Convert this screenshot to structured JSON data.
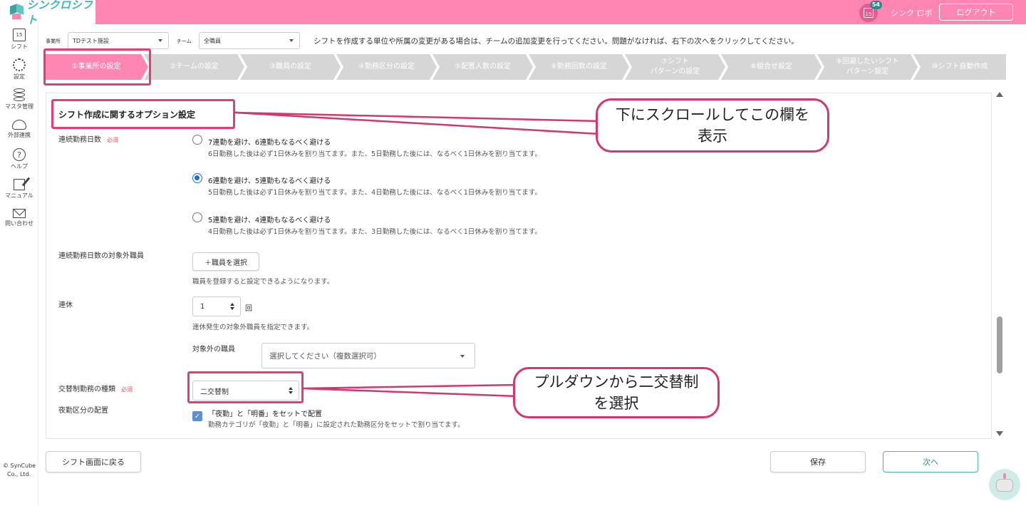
{
  "header": {
    "logo_text": "シンクロシフト",
    "calendar_day": "15",
    "notification_count": "54",
    "user_name": "シンク ロボ",
    "logout_label": "ログアウト"
  },
  "sidebar": {
    "items": [
      {
        "label": "シフト",
        "icon": "calendar-icon",
        "icon_text": "15"
      },
      {
        "label": "設定",
        "icon": "gear-icon"
      },
      {
        "label": "マスタ管理",
        "icon": "database-icon"
      },
      {
        "label": "外部連携",
        "icon": "cloud-icon"
      },
      {
        "label": "ヘルプ",
        "icon": "help-icon",
        "icon_text": "?"
      },
      {
        "label": "マニュアル",
        "icon": "edit-icon"
      },
      {
        "label": "問い合わせ",
        "icon": "mail-icon"
      }
    ],
    "copyright_line1": "© SynCube",
    "copyright_line2": "Co., Ltd."
  },
  "filters": {
    "office_label": "事業所",
    "office_value": "TDテスト施設",
    "team_label": "チーム",
    "team_value": "全職員"
  },
  "instruction": "シフトを作成する単位や所属の変更がある場合は、チームの追加変更を行ってください。問題がなければ、右下の次へをクリックしてください。",
  "steps": [
    {
      "line1": "①事業所の設定",
      "line2": "",
      "active": true
    },
    {
      "line1": "②チームの設定",
      "line2": ""
    },
    {
      "line1": "③職員の設定",
      "line2": ""
    },
    {
      "line1": "④勤務区分の設定",
      "line2": ""
    },
    {
      "line1": "⑤配置人数の設定",
      "line2": ""
    },
    {
      "line1": "⑥勤務回数の設定",
      "line2": ""
    },
    {
      "line1": "⑦シフト",
      "line2": "パターンの設定"
    },
    {
      "line1": "⑧組合せ設定",
      "line2": ""
    },
    {
      "line1": "⑨回避したいシフト",
      "line2": "パターン設定"
    },
    {
      "line1": "⑩シフト自動作成",
      "line2": ""
    }
  ],
  "section": {
    "title": "シフト作成に関するオプション設定",
    "consecutive": {
      "label": "連続勤務日数",
      "required": "必須",
      "options": [
        {
          "title": "7連勤を避け、6連勤もなるべく避ける",
          "desc": "6日勤務した後は必ず1日休みを割り当てます。また、5日勤務した後には、なるべく1日休みを割り当てます。",
          "checked": false
        },
        {
          "title": "6連勤を避け、5連勤もなるべく避ける",
          "desc": "5日勤務した後は必ず1日休みを割り当てます。また、4日勤務した後には、なるべく1日休みを割り当てます。",
          "checked": true
        },
        {
          "title": "5連勤を避け、4連勤もなるべく避ける",
          "desc": "4日勤務した後は必ず1日休みを割り当てます。また、3日勤務した後には、なるべく1日休みを割り当てます。",
          "checked": false
        }
      ]
    },
    "excluded": {
      "label": "連続勤務日数の対象外職員",
      "button": "＋職員を選択",
      "hint": "職員を登録すると設定できるようになります。"
    },
    "holiday": {
      "label": "連休",
      "value": "1",
      "unit": "回",
      "hint": "連休発生の対象外職員を指定できます。",
      "excluded_label": "対象外の職員",
      "excluded_placeholder": "選択してください（複数選択可）"
    },
    "shift_type": {
      "label": "交替制勤務の種類",
      "required": "必須",
      "value": "二交替制"
    },
    "night": {
      "label": "夜勤区分の配置",
      "checkbox_label": "「夜勤」と「明番」をセットで配置",
      "desc": "勤務カテゴリが「夜勤」と「明番」に設定された勤務区分をセットで割り当てます。",
      "checked": true
    }
  },
  "footer": {
    "back_label": "シフト画面に戻る",
    "save_label": "保存",
    "next_label": "次へ"
  },
  "callouts": {
    "scroll_line1": "下にスクロールしてこの欄を",
    "scroll_line2": "表示",
    "pulldown_line1": "プルダウンから二交替制",
    "pulldown_line2": "を選択"
  },
  "colors": {
    "header_pink": "#ff86b3",
    "highlight_red": "#e0406f",
    "radio_blue": "#1a6fd8",
    "next_teal": "#4cb5ad"
  }
}
